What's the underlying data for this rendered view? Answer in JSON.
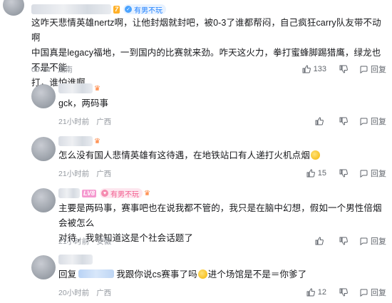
{
  "comments": [
    {
      "level": "7",
      "badge": "有男不玩",
      "text_lines": [
        "这咋天悲情英雄nertz啊，让他封烟就封吧，被0-3了谁都帮闷，自己疯狂carry队友带不动啊",
        "中国真是legacy福地，一到国内的比赛就来劲。咋天这火力，拳打蜜蜂脚踢猎鹰，绿龙也不是不能",
        "打，谁怕谁啊"
      ],
      "date": "09-14",
      "location": "湖南",
      "likes": "133",
      "reply_label": "回复"
    },
    {
      "text": "gck，两码事",
      "time": "21小时前",
      "location": "广西",
      "likes": "",
      "reply_label": "回复"
    },
    {
      "text": "怎么没有国人悲情英雄有这待遇，在地铁站口有人递打火机点烟",
      "time": "21小时前",
      "location": "广西",
      "likes": "15",
      "reply_label": "回复"
    },
    {
      "level": "LV8",
      "badge": "有男不玩",
      "text_lines": [
        "主要是两码事，赛事吧也在说我都不管的，我只是在脑中幻想，假如一个男性倍烟会被怎么",
        "对待，我就知道这是个社会话题了"
      ],
      "time": "21小时前",
      "location": "安徽",
      "likes": "",
      "reply_label": "回复"
    },
    {
      "prefix": "回复",
      "text_a": "我跟你说cs赛事了吗",
      "text_b": "进个场馆是不是＝你爹了",
      "time": "20小时前",
      "location": "广西",
      "likes": "12",
      "reply_label": "回复"
    }
  ],
  "colors": {
    "meta": "#9499a0",
    "badge_blue": "#1e80ff",
    "badge_pink": "#f25d8e"
  }
}
